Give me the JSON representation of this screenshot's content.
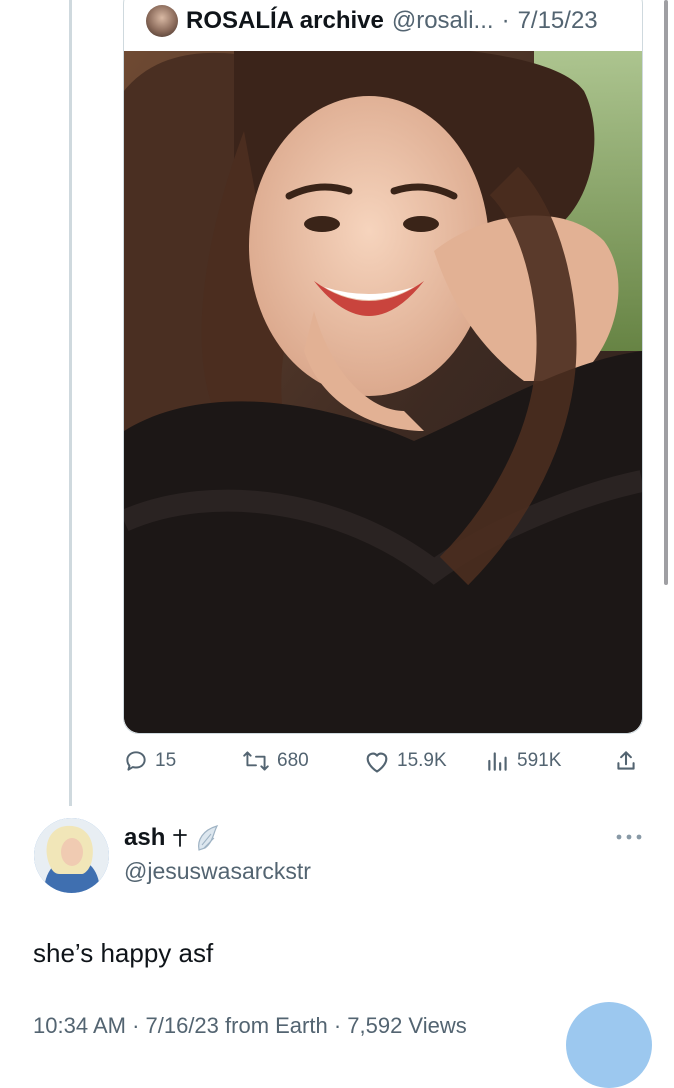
{
  "quote_tweet": {
    "author_name": "ROSALÍA archive",
    "author_handle": "@rosali...",
    "separator": "·",
    "date": "7/15/23",
    "avatar_icon": "profile-photo",
    "media": "photo"
  },
  "actions": {
    "replies": "15",
    "retweets": "680",
    "likes": "15.9K",
    "views": "591K",
    "icons": [
      "reply-icon",
      "retweet-icon",
      "like-icon",
      "views-icon",
      "share-icon"
    ]
  },
  "reply_tweet": {
    "author_name": "ash",
    "name_emojis": [
      "cross-icon",
      "wing-icon"
    ],
    "author_handle": "@jesuswasarckstr",
    "text": "she’s happy asf",
    "meta_partial": "10:34 AM · 7/16/23 from Earth · 7,592 Views"
  },
  "colors": {
    "muted_text": "#536471",
    "thread_line": "#cfd9de",
    "fab_blue": "#9cc8ef"
  }
}
